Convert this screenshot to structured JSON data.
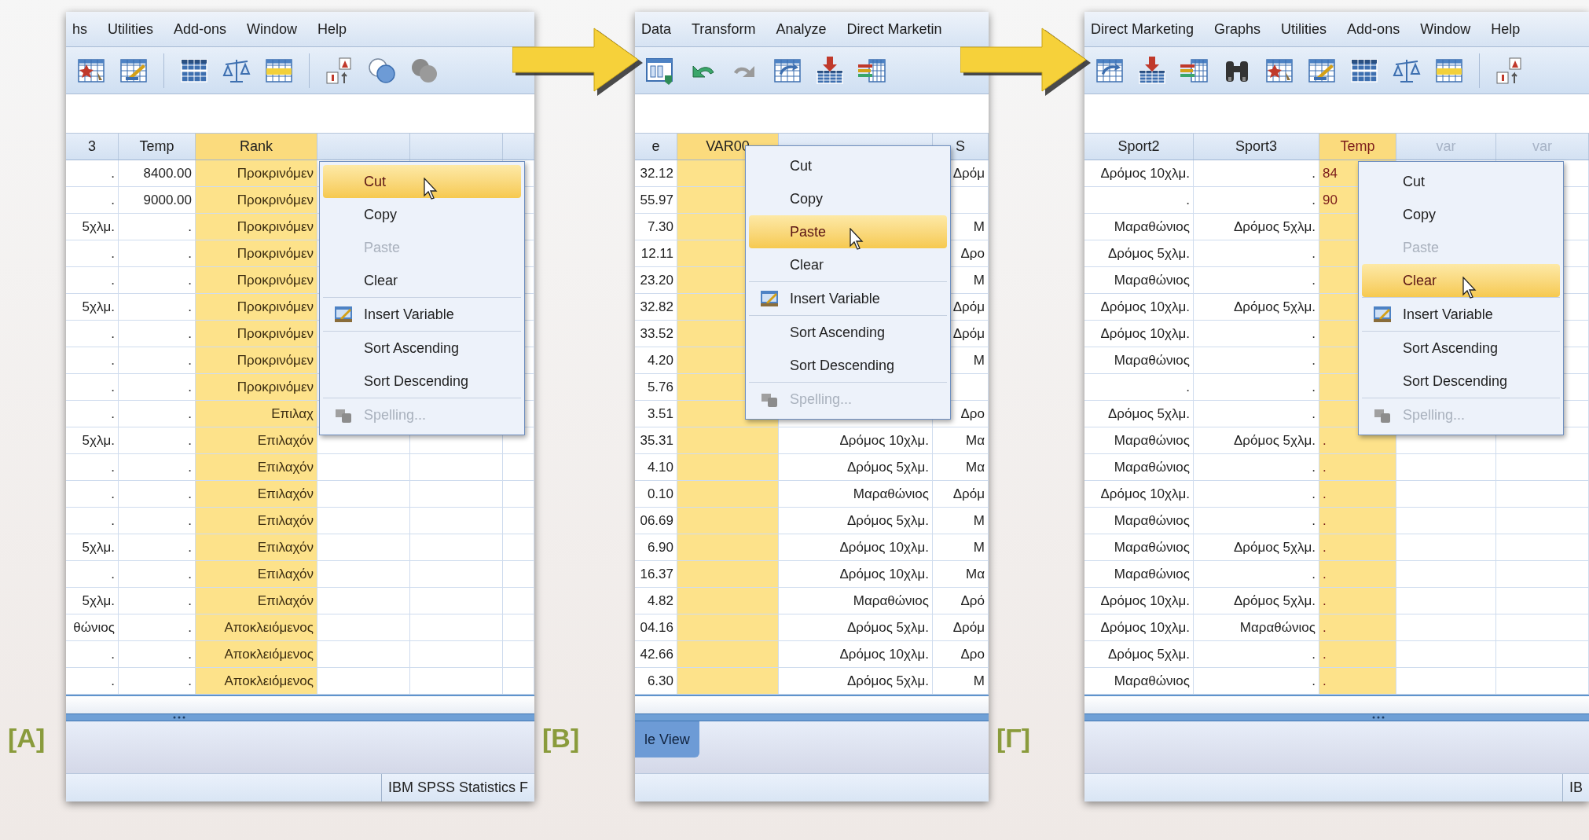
{
  "panels": [
    {
      "label": "[A]",
      "menu_bar": [
        "hs",
        "Utilities",
        "Add-ons",
        "Window",
        "Help"
      ],
      "toolbar": [
        {
          "kind": "grid-star"
        },
        {
          "kind": "grid-pen"
        },
        {
          "kind": "separator"
        },
        {
          "kind": "grid-dark"
        },
        {
          "kind": "scales"
        },
        {
          "kind": "grid-yellow"
        },
        {
          "kind": "separator"
        },
        {
          "kind": "value-labels"
        },
        {
          "kind": "circles"
        },
        {
          "kind": "circles-grey"
        }
      ],
      "columns": [
        {
          "label": "3",
          "selected": false
        },
        {
          "label": "Temp",
          "selected": false
        },
        {
          "label": "Rank",
          "selected": true
        },
        {
          "selected": false
        },
        {
          "selected": false
        },
        {
          "selected": false
        }
      ],
      "rows": [
        [
          ".",
          "8400.00",
          "Προκρινόμεν"
        ],
        [
          ".",
          "9000.00",
          "Προκρινόμεν"
        ],
        [
          "5χλμ.",
          ".",
          "Προκρινόμεν"
        ],
        [
          ".",
          ".",
          "Προκρινόμεν"
        ],
        [
          ".",
          ".",
          "Προκρινόμεν"
        ],
        [
          "5χλμ.",
          ".",
          "Προκρινόμεν"
        ],
        [
          ".",
          ".",
          "Προκρινόμεν"
        ],
        [
          ".",
          ".",
          "Προκρινόμεν"
        ],
        [
          ".",
          ".",
          "Προκρινόμεν"
        ],
        [
          ".",
          ".",
          "Επιλαχ"
        ],
        [
          "5χλμ.",
          ".",
          "Επιλαχόν"
        ],
        [
          ".",
          ".",
          "Επιλαχόν"
        ],
        [
          ".",
          ".",
          "Επιλαχόν"
        ],
        [
          ".",
          ".",
          "Επιλαχόν"
        ],
        [
          "5χλμ.",
          ".",
          "Επιλαχόν"
        ],
        [
          ".",
          ".",
          "Επιλαχόν"
        ],
        [
          "5χλμ.",
          ".",
          "Επιλαχόν"
        ],
        [
          "θώνιος",
          ".",
          "Αποκλειόμενος"
        ],
        [
          ".",
          ".",
          "Αποκλειόμενος"
        ],
        [
          ".",
          ".",
          "Αποκλειόμενος"
        ]
      ],
      "context_menu": [
        [
          {
            "label": "Cut",
            "kind": "plain",
            "selected": true,
            "disabled": false
          },
          {
            "label": "Copy",
            "kind": "plain",
            "selected": false,
            "disabled": false
          },
          {
            "label": "Paste",
            "kind": "plain",
            "selected": false,
            "disabled": true
          },
          {
            "label": "Clear",
            "kind": "plain",
            "selected": false,
            "disabled": false
          }
        ],
        [
          {
            "label": "Insert Variable",
            "kind": "variable",
            "selected": false,
            "disabled": false
          }
        ],
        [
          {
            "label": "Sort Ascending",
            "kind": "plain",
            "selected": false,
            "disabled": false
          },
          {
            "label": "Sort Descending",
            "kind": "plain",
            "selected": false,
            "disabled": false
          }
        ],
        [
          {
            "label": "Spelling...",
            "kind": "spelling",
            "selected": false,
            "disabled": true
          }
        ]
      ],
      "status": "IBM SPSS Statistics F"
    },
    {
      "label": "[B]",
      "menu_bar": [
        "Data",
        "Transform",
        "Analyze",
        "Direct Marketin"
      ],
      "toolbar": [
        {
          "kind": "dialog"
        },
        {
          "kind": "undo"
        },
        {
          "kind": "redo"
        },
        {
          "kind": "grid-arrow"
        },
        {
          "kind": "arrow-grid"
        },
        {
          "kind": "bars-grid"
        }
      ],
      "columns": [
        {
          "label": "e",
          "selected": false
        },
        {
          "label": "VAR00",
          "selected": true
        },
        {
          "selected": false
        },
        {
          "label": "S",
          "selected": false
        }
      ],
      "rows": [
        [
          "32.12",
          null,
          null,
          "Δρόμ"
        ],
        [
          "55.97"
        ],
        [
          "7.30",
          null,
          null,
          "Μ"
        ],
        [
          "12.11",
          null,
          null,
          "Δρο"
        ],
        [
          "23.20",
          null,
          null,
          "Μ"
        ],
        [
          "32.82",
          null,
          null,
          "Δρόμ"
        ],
        [
          "33.52",
          null,
          null,
          "Δρόμ"
        ],
        [
          "4.20",
          null,
          null,
          "Μ"
        ],
        [
          "5.76"
        ],
        [
          "3.51",
          null,
          null,
          "Δρο"
        ],
        [
          "35.31",
          null,
          "Δρόμος 10χλμ.",
          "Μα"
        ],
        [
          "4.10",
          null,
          "Δρόμος 5χλμ.",
          "Μα"
        ],
        [
          "0.10",
          null,
          "Μαραθώνιος",
          "Δρόμ"
        ],
        [
          "06.69",
          null,
          "Δρόμος 5χλμ.",
          "Μ"
        ],
        [
          "6.90",
          null,
          "Δρόμος 10χλμ.",
          "Μ"
        ],
        [
          "16.37",
          null,
          "Δρόμος 10χλμ.",
          "Μα"
        ],
        [
          "4.82",
          null,
          "Μαραθώνιος",
          "Δρό"
        ],
        [
          "04.16",
          null,
          "Δρόμος 5χλμ.",
          "Δρόμ"
        ],
        [
          "42.66",
          null,
          "Δρόμος 10χλμ.",
          "Δρο"
        ],
        [
          "6.30",
          null,
          "Δρόμος 5χλμ.",
          "Μ"
        ]
      ],
      "context_menu": [
        [
          {
            "label": "Cut",
            "kind": "plain",
            "selected": false,
            "disabled": false
          },
          {
            "label": "Copy",
            "kind": "plain",
            "selected": false,
            "disabled": false
          },
          {
            "label": "Paste",
            "kind": "plain",
            "selected": true,
            "disabled": false
          },
          {
            "label": "Clear",
            "kind": "plain",
            "selected": false,
            "disabled": false
          }
        ],
        [
          {
            "label": "Insert Variable",
            "kind": "variable",
            "selected": false,
            "disabled": false
          }
        ],
        [
          {
            "label": "Sort Ascending",
            "kind": "plain",
            "selected": false,
            "disabled": false
          },
          {
            "label": "Sort Descending",
            "kind": "plain",
            "selected": false,
            "disabled": false
          }
        ],
        [
          {
            "label": "Spelling...",
            "kind": "spelling",
            "selected": false,
            "disabled": true
          }
        ]
      ],
      "tabs": [
        {
          "label": "le View",
          "selected": true
        }
      ]
    },
    {
      "label": "[Γ]",
      "menu_bar": [
        "Direct Marketing",
        "Graphs",
        "Utilities",
        "Add-ons",
        "Window",
        "Help"
      ],
      "toolbar": [
        {
          "kind": "grid-arrow"
        },
        {
          "kind": "arrow-grid"
        },
        {
          "kind": "bars-grid"
        },
        {
          "kind": "binoculars"
        },
        {
          "kind": "grid-star"
        },
        {
          "kind": "grid-pen"
        },
        {
          "kind": "grid-dark"
        },
        {
          "kind": "scales"
        },
        {
          "kind": "grid-yellow"
        },
        {
          "kind": "separator"
        },
        {
          "kind": "value-labels"
        }
      ],
      "columns": [
        {
          "label": "Sport2",
          "selected": false
        },
        {
          "label": "Sport3",
          "selected": false
        },
        {
          "label": "Temp",
          "selected": true
        },
        {
          "label": "var",
          "selected": false,
          "empty": true
        },
        {
          "label": "var",
          "selected": false,
          "empty": true
        }
      ],
      "rows": [
        [
          "Δρόμος 10χλμ.",
          ".",
          "84"
        ],
        [
          ".",
          ".",
          "90"
        ],
        [
          "Μαραθώνιος",
          "Δρόμος 5χλμ."
        ],
        [
          "Δρόμος 5χλμ.",
          "."
        ],
        [
          "Μαραθώνιος",
          "."
        ],
        [
          "Δρόμος 10χλμ.",
          "Δρόμος 5χλμ."
        ],
        [
          "Δρόμος 10χλμ.",
          "."
        ],
        [
          "Μαραθώνιος",
          "."
        ],
        [
          ".",
          "."
        ],
        [
          "Δρόμος 5χλμ.",
          "."
        ],
        [
          "Μαραθώνιος",
          "Δρόμος 5χλμ.",
          "."
        ],
        [
          "Μαραθώνιος",
          ".",
          "."
        ],
        [
          "Δρόμος 10χλμ.",
          ".",
          "."
        ],
        [
          "Μαραθώνιος",
          ".",
          "."
        ],
        [
          "Μαραθώνιος",
          "Δρόμος 5χλμ.",
          "."
        ],
        [
          "Μαραθώνιος",
          ".",
          "."
        ],
        [
          "Δρόμος 10χλμ.",
          "Δρόμος 5χλμ.",
          "."
        ],
        [
          "Δρόμος 10χλμ.",
          "Μαραθώνιος",
          "."
        ],
        [
          "Δρόμος 5χλμ.",
          ".",
          "."
        ],
        [
          "Μαραθώνιος",
          ".",
          "."
        ]
      ],
      "context_menu": [
        [
          {
            "label": "Cut",
            "kind": "plain",
            "selected": false,
            "disabled": false
          },
          {
            "label": "Copy",
            "kind": "plain",
            "selected": false,
            "disabled": false
          },
          {
            "label": "Paste",
            "kind": "plain",
            "selected": false,
            "disabled": true
          },
          {
            "label": "Clear",
            "kind": "plain",
            "selected": true,
            "disabled": false
          }
        ],
        [
          {
            "label": "Insert Variable",
            "kind": "variable",
            "selected": false,
            "disabled": false
          }
        ],
        [
          {
            "label": "Sort Ascending",
            "kind": "plain",
            "selected": false,
            "disabled": false
          },
          {
            "label": "Sort Descending",
            "kind": "plain",
            "selected": false,
            "disabled": false
          }
        ],
        [
          {
            "label": "Spelling...",
            "kind": "spelling",
            "selected": false,
            "disabled": true
          }
        ]
      ],
      "status": "IB"
    }
  ]
}
